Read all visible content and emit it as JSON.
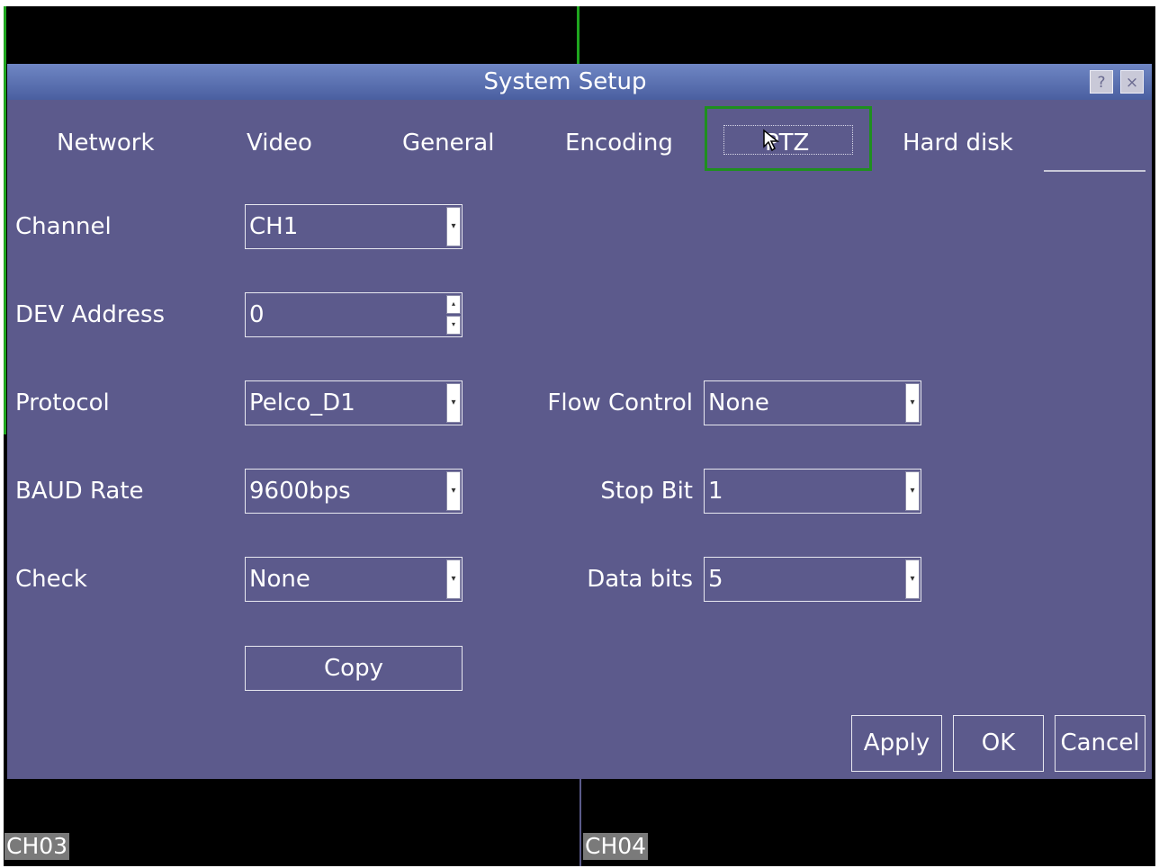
{
  "dialog": {
    "title": "System Setup",
    "help_label": "?",
    "close_label": "×"
  },
  "tabs": [
    {
      "label": "Network"
    },
    {
      "label": "Video"
    },
    {
      "label": "General"
    },
    {
      "label": "Encoding"
    },
    {
      "label": "PTZ",
      "selected": true
    },
    {
      "label": "Hard disk"
    }
  ],
  "form": {
    "channel": {
      "label": "Channel",
      "value": "CH1"
    },
    "dev_address": {
      "label": "DEV Address",
      "value": "0"
    },
    "protocol": {
      "label": "Protocol",
      "value": "Pelco_D1"
    },
    "baud_rate": {
      "label": "BAUD Rate",
      "value": "9600bps"
    },
    "check": {
      "label": "Check",
      "value": "None"
    },
    "flow_control": {
      "label": "Flow Control",
      "value": "None"
    },
    "stop_bit": {
      "label": "Stop Bit",
      "value": "1"
    },
    "data_bits": {
      "label": "Data bits",
      "value": "5"
    }
  },
  "buttons": {
    "copy": "Copy",
    "apply": "Apply",
    "ok": "OK",
    "cancel": "Cancel"
  },
  "channels": {
    "ch03": "CH03",
    "ch04": "CH04"
  },
  "colors": {
    "dialog_bg": "#5c5a8c",
    "titlebar": "#5a72b4",
    "selection_frame": "#1f8f1f"
  }
}
